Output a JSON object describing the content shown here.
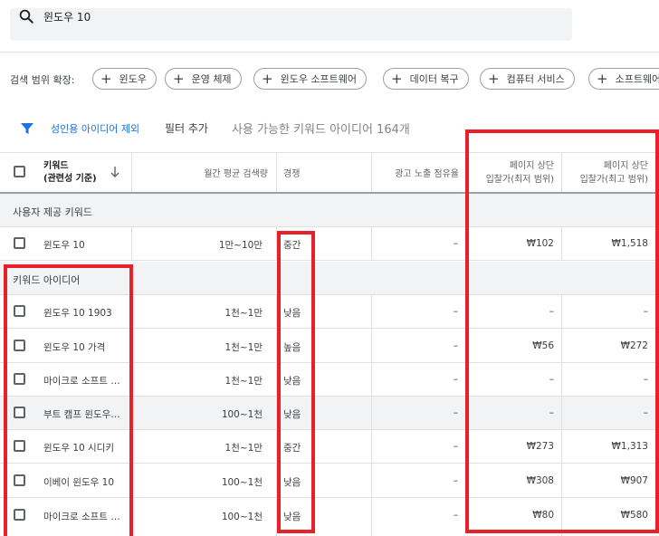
{
  "search": {
    "value": "윈도우 10"
  },
  "expand": {
    "label": "검색 범위 확장:",
    "chips": [
      "윈도우",
      "운영 체제",
      "윈도우 소프트웨어",
      "데이터 복구",
      "컴퓨터 서비스",
      "소프트웨어"
    ]
  },
  "filters": {
    "adult_exclude": "성인용 아이디어 제외",
    "add_filter": "필터 추가",
    "available": "사용 가능한 키워드 아이디어 164개"
  },
  "table": {
    "headers": {
      "keyword_line1": "키워드",
      "keyword_line2": "(관련성 기준)",
      "monthly": "월간 평균 검색량",
      "competition": "경쟁",
      "impression_share": "광고 노출 점유율",
      "bid_low_line1": "페이지 상단",
      "bid_low_line2": "입찰가(최저 범위)",
      "bid_high_line1": "페이지 상단",
      "bid_high_line2": "입찰가(최고 범위)"
    },
    "section_user": "사용자 제공 키워드",
    "section_ideas": "키워드 아이디어",
    "user_rows": [
      {
        "keyword": "윈도우 10",
        "monthly": "1만~10만",
        "competition": "중간",
        "impression": "–",
        "bid_low": "₩102",
        "bid_high": "₩1,518"
      }
    ],
    "idea_rows": [
      {
        "keyword": "윈도우 10 1903",
        "monthly": "1천~1만",
        "competition": "낮음",
        "impression": "–",
        "bid_low": "–",
        "bid_high": "–"
      },
      {
        "keyword": "윈도우 10 가격",
        "monthly": "1천~1만",
        "competition": "높음",
        "impression": "–",
        "bid_low": "₩56",
        "bid_high": "₩272"
      },
      {
        "keyword": "마이크로 소프트 …",
        "monthly": "1천~1만",
        "competition": "낮음",
        "impression": "–",
        "bid_low": "–",
        "bid_high": "–"
      },
      {
        "keyword": "부트 캠프 윈도우…",
        "monthly": "100~1천",
        "competition": "낮음",
        "impression": "–",
        "bid_low": "–",
        "bid_high": "–"
      },
      {
        "keyword": "윈도우 10 시디키",
        "monthly": "1천~1만",
        "competition": "중간",
        "impression": "–",
        "bid_low": "₩273",
        "bid_high": "₩1,313"
      },
      {
        "keyword": "이베이 윈도우 10",
        "monthly": "100~1천",
        "competition": "낮음",
        "impression": "–",
        "bid_low": "₩308",
        "bid_high": "₩907"
      },
      {
        "keyword": "마이크로 소프트 …",
        "monthly": "100~1천",
        "competition": "낮음",
        "impression": "–",
        "bid_low": "₩80",
        "bid_high": "₩580"
      }
    ]
  },
  "colors": {
    "accent": "#1a73e8",
    "highlight": "#e8202a"
  }
}
